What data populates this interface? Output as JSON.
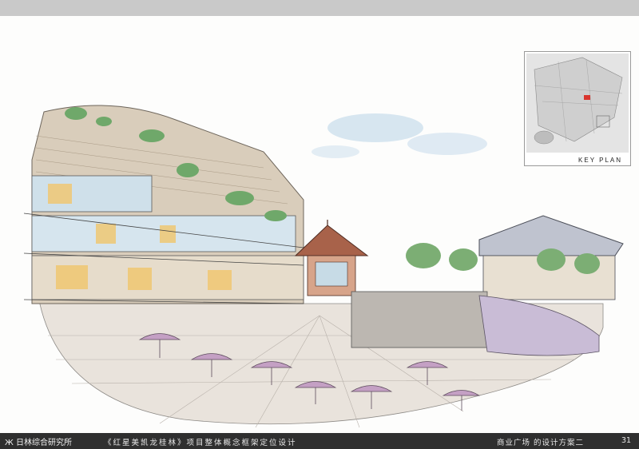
{
  "key_plan": {
    "label": "KEY PLAN"
  },
  "footer": {
    "logo_mark": "Ж",
    "logo_text": "日林综合研究所",
    "title": "《红星美凯龙桂林》项目整体概念框架定位设计",
    "caption": "商业广场 的设计方案二",
    "page": "31"
  }
}
